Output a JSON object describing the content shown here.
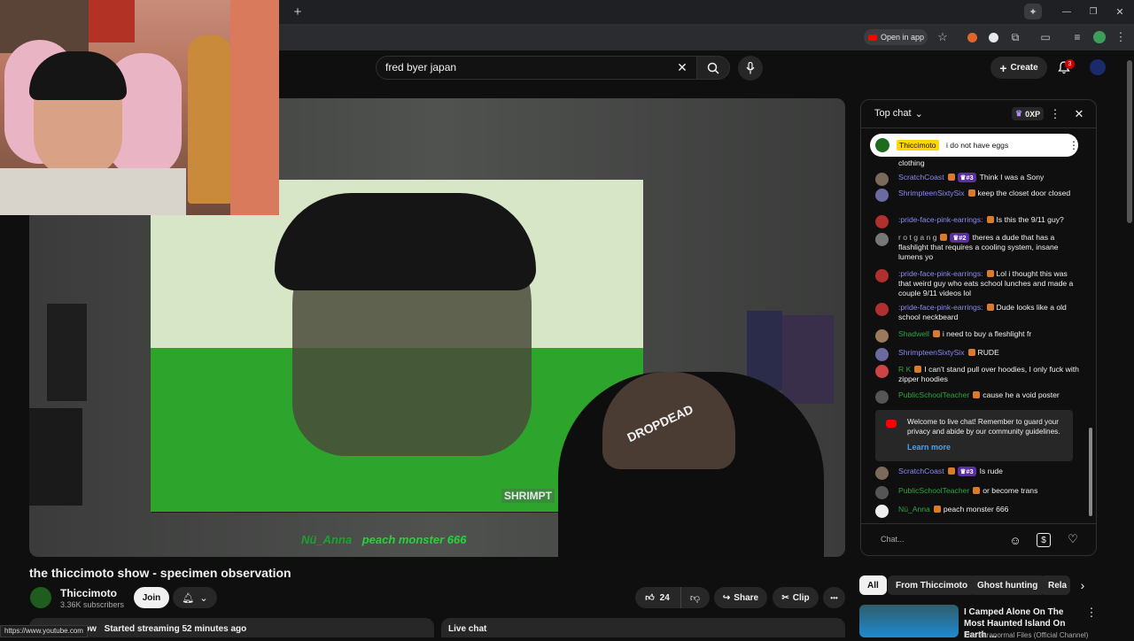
{
  "browser": {
    "new_tab": "+",
    "open_in_app": "Open in app",
    "status_url": "https://www.youtube.com",
    "win_min": "—",
    "win_restore": "❐",
    "win_close": "✕"
  },
  "masthead": {
    "search_value": "fred byer japan",
    "create_label": "Create",
    "notification_count": "3"
  },
  "video": {
    "title": "the thiccimoto show - specimen observation",
    "overlay_chat_author": "Nü_Anna",
    "overlay_chat_text": "peach monster 666",
    "on_screen_caption": "SHRIMPT",
    "cap_text": "DROPDEAD"
  },
  "channel": {
    "name": "Thiccimoto",
    "subscribers": "3.36K subscribers",
    "join_label": "Join"
  },
  "actions": {
    "likes": "24",
    "share_label": "Share",
    "clip_label": "Clip",
    "more": "•••"
  },
  "meta": {
    "cut_word": "ow",
    "streaming": "Started streaming 52 minutes ago",
    "live_chat_label": "Live chat"
  },
  "chat": {
    "mode_label": "Top chat",
    "xp_label": "0XP",
    "pinned": {
      "author": "Thiccimoto",
      "text": "i do not have eggs"
    },
    "cut_text": "clothing",
    "messages": [
      {
        "author": "ScratchCoast",
        "rank": "#3",
        "text": "Think I was a Sony",
        "color": "#8a8af5"
      },
      {
        "author": "ShrimpteenSixtySix",
        "rank": "",
        "text": "keep the closet door closed",
        "color": "#8a8af5"
      },
      {
        "author": ":pride-face-pink-earrings:",
        "rank": "",
        "text": "Is this the 9/11 guy?",
        "color": "#8a8af5"
      },
      {
        "author": "r o t g a n g",
        "rank": "#2",
        "text": "theres a dude that has a flashlight that requires a cooling system, insane lumens yo",
        "color": "#bdbdbd"
      },
      {
        "author": ":pride-face-pink-earrings:",
        "rank": "",
        "text": "Lol i thought this was that weird guy who eats school lunches and made a couple 9/11 videos lol",
        "color": "#8a8af5"
      },
      {
        "author": ":pride-face-pink-earrings:",
        "rank": "",
        "text": "Dude looks like a old school neckbeard",
        "color": "#8a8af5"
      },
      {
        "author": "Shadwell",
        "rank": "",
        "text": "i need to buy a fleshlight fr",
        "color": "#2ba640"
      },
      {
        "author": "ShrimpteenSixtySix",
        "rank": "",
        "text": "RUDE",
        "color": "#8a8af5"
      },
      {
        "author": "R K",
        "rank": "",
        "text": "I can't stand pull over hoodies, I only fuck with zipper hoodies",
        "color": "#2ba640"
      },
      {
        "author": "PublicSchoolTeacher",
        "rank": "",
        "text": "cause he a void poster",
        "color": "#2ba640"
      }
    ],
    "welcome_text": "Welcome to live chat! Remember to guard your privacy and abide by our community guidelines.",
    "learn_more": "Learn more",
    "messages_after": [
      {
        "author": "ScratchCoast",
        "rank": "#3",
        "text": "Is rude",
        "color": "#8a8af5"
      },
      {
        "author": "PublicSchoolTeacher",
        "rank": "",
        "text": "or become trans",
        "color": "#2ba640"
      },
      {
        "author": "Nü_Anna",
        "rank": "",
        "text": "peach monster 666",
        "color": "#2ba640"
      }
    ],
    "input_placeholder": "Chat..."
  },
  "chips": [
    "All",
    "From Thiccimoto",
    "Ghost hunting",
    "Rela"
  ],
  "recommendation": {
    "title": "I Camped Alone On The Most Haunted Island On Earth ...",
    "channel": "The Paranormal Files (Official Channel)"
  }
}
